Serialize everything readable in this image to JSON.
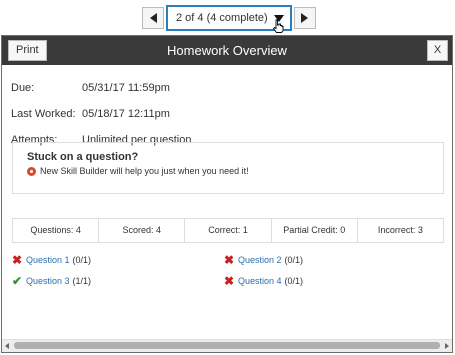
{
  "nav": {
    "selector_text": "2 of 4 (4 complete)"
  },
  "modal": {
    "title": "Homework Overview",
    "print_label": "Print",
    "close_label": "X"
  },
  "info": {
    "due_label": "Due:",
    "due_value": "05/31/17 11:59pm",
    "last_worked_label": "Last Worked:",
    "last_worked_value": "05/18/17 12:11pm",
    "attempts_label": "Attempts:",
    "attempts_value": "Unlimited per question"
  },
  "stuck": {
    "title": "Stuck on a question?",
    "message": "New Skill Builder will help you just when you need it!"
  },
  "stats": {
    "questions": "Questions: 4",
    "scored": "Scored: 4",
    "correct": "Correct: 1",
    "partial": "Partial Credit: 0",
    "incorrect": "Incorrect: 3"
  },
  "questions": [
    {
      "label": "Question 1",
      "score": "(0/1)",
      "status": "incorrect"
    },
    {
      "label": "Question 2",
      "score": "(0/1)",
      "status": "incorrect"
    },
    {
      "label": "Question 3",
      "score": "(1/1)",
      "status": "correct"
    },
    {
      "label": "Question 4",
      "score": "(0/1)",
      "status": "incorrect"
    }
  ],
  "colors": {
    "header_bg": "#3a3a3a",
    "link": "#2a6fb0",
    "incorrect": "#cc1f1f",
    "correct": "#2f9a2f",
    "selector_border": "#2a7fc0"
  }
}
